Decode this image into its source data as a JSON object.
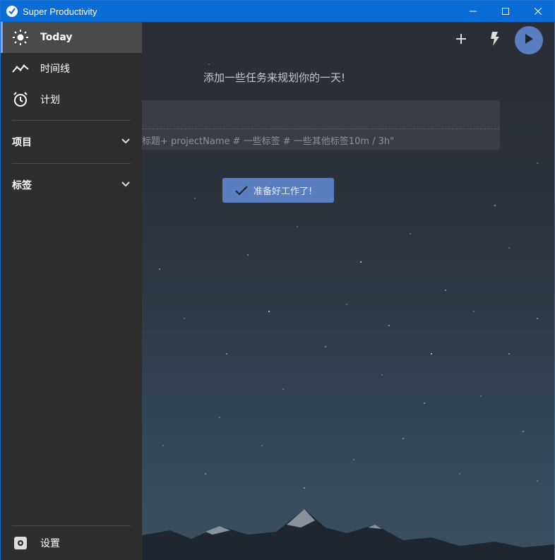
{
  "window": {
    "title": "Super Productivity",
    "accent": "#0a6cd5"
  },
  "sidebar": {
    "items": [
      {
        "label": "Today",
        "icon": "sun-icon",
        "active": true
      },
      {
        "label": "时间线",
        "icon": "timeline-icon"
      },
      {
        "label": "计划",
        "icon": "alarm-clock-icon"
      }
    ],
    "sections": [
      {
        "label": "项目",
        "icon": "chevron-down-icon"
      },
      {
        "label": "标签",
        "icon": "chevron-down-icon"
      }
    ],
    "settings_label": "设置"
  },
  "toolbar": {
    "add_icon": "plus-icon",
    "flash_icon": "lightning-icon",
    "play_icon": "play-icon",
    "play_color": "#5b7ec0"
  },
  "main": {
    "heading": "添加一些任务来规划你的一天!",
    "input_placeholder": "标题+ projectName # 一些标签 # 一些其他标签10m / 3h\"",
    "ready_button": "准备好工作了!"
  }
}
